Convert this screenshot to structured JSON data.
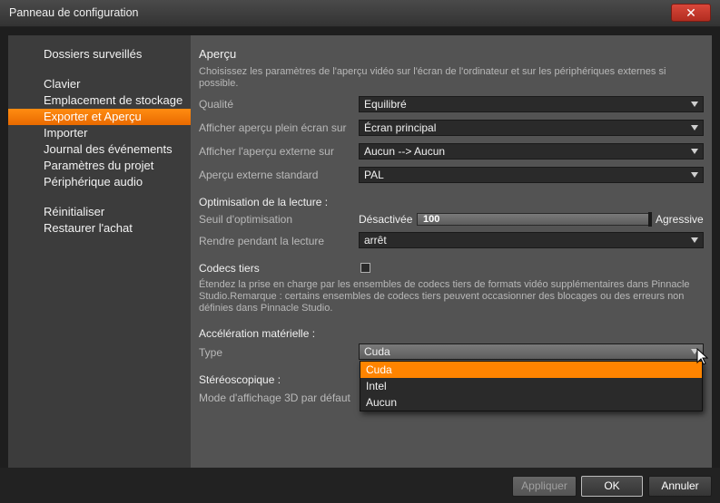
{
  "window": {
    "title": "Panneau de configuration",
    "close_glyph": "✕"
  },
  "sidebar": {
    "items": [
      {
        "label": "Dossiers surveillés",
        "active": false
      },
      {
        "label": "Clavier",
        "active": false
      },
      {
        "label": "Emplacement de stockage",
        "active": false
      },
      {
        "label": "Exporter et Aperçu",
        "active": true
      },
      {
        "label": "Importer",
        "active": false
      },
      {
        "label": "Journal des événements",
        "active": false
      },
      {
        "label": "Paramètres du projet",
        "active": false
      },
      {
        "label": "Périphérique audio",
        "active": false
      },
      {
        "label": "Réinitialiser",
        "active": false
      },
      {
        "label": "Restaurer l'achat",
        "active": false
      }
    ]
  },
  "preview": {
    "title": "Aperçu",
    "description": "Choisissez les paramètres de l'aperçu vidéo sur l'écran de l'ordinateur et sur les périphériques externes si possible.",
    "quality": {
      "label": "Qualité",
      "value": "Equilibré"
    },
    "fullscreen": {
      "label": "Afficher aperçu plein écran sur",
      "value": "Écran principal"
    },
    "external": {
      "label": "Afficher l'aperçu externe sur",
      "value": "Aucun --> Aucun"
    },
    "external_standard": {
      "label": "Aperçu externe standard",
      "value": "PAL"
    }
  },
  "playback": {
    "title": "Optimisation de la lecture :",
    "threshold_label": "Seuil d'optimisation",
    "slider_min_label": "Désactivée",
    "slider_max_label": "Agressive",
    "slider_value": "100",
    "slider_fraction": 1.0,
    "render": {
      "label": "Rendre pendant la lecture",
      "value": "arrêt"
    }
  },
  "codecs": {
    "title": "Codecs tiers",
    "checked": false,
    "description": "Étendez la prise en charge par les ensembles de codecs tiers de formats vidéo supplémentaires dans Pinnacle Studio.Remarque : certains ensembles de codecs tiers peuvent occasionner des blocages ou des erreurs non définies dans Pinnacle Studio."
  },
  "hardware": {
    "title": "Accélération matérielle :",
    "type_label": "Type",
    "type_value": "Cuda",
    "options": [
      "Cuda",
      "Intel",
      "Aucun"
    ],
    "selected_index": 0
  },
  "stereo": {
    "title": "Stéréoscopique :",
    "mode_label": "Mode d'affichage 3D par défaut"
  },
  "buttons": {
    "apply": "Appliquer",
    "ok": "OK",
    "cancel": "Annuler"
  },
  "colors": {
    "accent": "#f27c00",
    "close": "#c83a2c",
    "panel": "#535353",
    "sidebar": "#3c3c3c"
  }
}
